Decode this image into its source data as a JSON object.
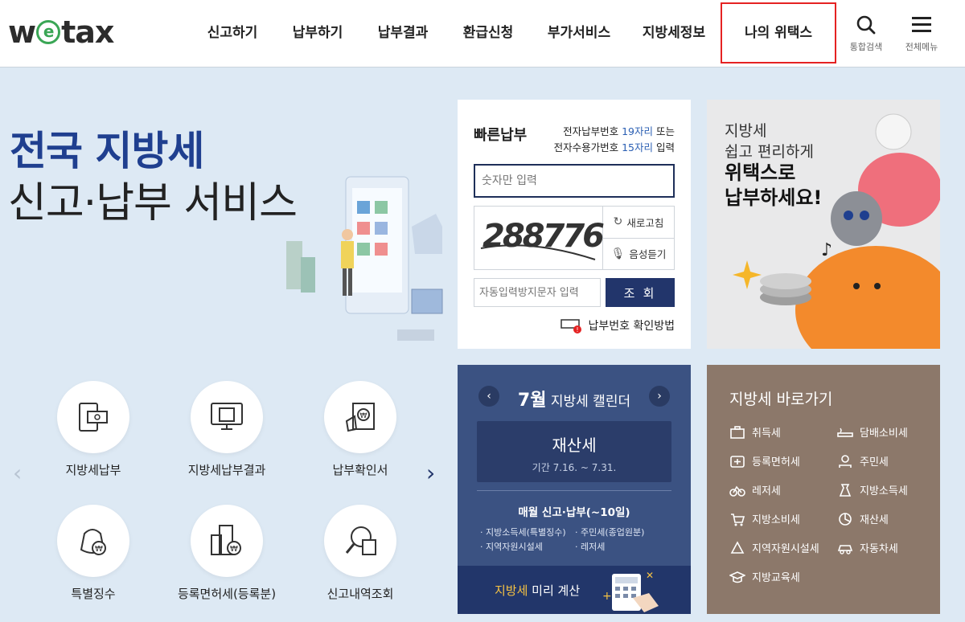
{
  "header": {
    "logo": "wetax",
    "nav": [
      "신고하기",
      "납부하기",
      "납부결과",
      "환급신청",
      "부가서비스",
      "지방세정보",
      "나의 위택스"
    ],
    "search_label": "통합검색",
    "menu_label": "전체메뉴"
  },
  "hero": {
    "title_line1": "전국 지방세",
    "title_line2": "신고·납부 서비스"
  },
  "services": [
    {
      "label": "지방세납부",
      "icon": "tax-payment-icon"
    },
    {
      "label": "지방세납부결과",
      "icon": "payment-result-icon"
    },
    {
      "label": "납부확인서",
      "icon": "payment-certificate-icon"
    },
    {
      "label": "특별징수",
      "icon": "special-collection-icon"
    },
    {
      "label": "등록면허세(등록분)",
      "icon": "registration-tax-icon"
    },
    {
      "label": "신고내역조회",
      "icon": "report-history-icon"
    }
  ],
  "quick_pay": {
    "title": "빠른납부",
    "info_line1_pre": "전자납부번호 ",
    "info_line1_num": "19자리",
    "info_line1_post": " 또는",
    "info_line2_pre": "전자수용가번호 ",
    "info_line2_num": "15자리",
    "info_line2_post": " 입력",
    "input_placeholder": "숫자만 입력",
    "captcha_text": "288776",
    "refresh_label": "새로고침",
    "audio_label": "음성듣기",
    "auto_input_placeholder": "자동입력방지문자 입력",
    "query_button": "조 회",
    "help_link": "납부번호 확인방법"
  },
  "promo": {
    "line1": "지방세",
    "line2": "쉽고 편리하게",
    "line3": "위택스로",
    "line4": "납부하세요!"
  },
  "calendar": {
    "month": "7월",
    "title": "지방세 캘린더",
    "tax_name": "재산세",
    "period": "기간 7.16. ~ 7.31.",
    "monthly_title": "매월 신고·납부(~10일)",
    "items": [
      "지방소득세(특별징수)",
      "주민세(종업원분)",
      "지역자원시설세",
      "레저세"
    ],
    "calc_highlight": "지방세",
    "calc_rest": " 미리 계산"
  },
  "shortcuts": {
    "title": "지방세 바로가기",
    "items": [
      {
        "label": "취득세",
        "icon": "briefcase-icon"
      },
      {
        "label": "담배소비세",
        "icon": "cigarette-icon"
      },
      {
        "label": "등록면허세",
        "icon": "license-icon"
      },
      {
        "label": "주민세",
        "icon": "person-icon"
      },
      {
        "label": "레저세",
        "icon": "bicycle-icon"
      },
      {
        "label": "지방소득세",
        "icon": "money-bag-icon"
      },
      {
        "label": "지방소비세",
        "icon": "cart-icon"
      },
      {
        "label": "재산세",
        "icon": "pie-chart-icon"
      },
      {
        "label": "지역자원시설세",
        "icon": "recycle-icon"
      },
      {
        "label": "자동차세",
        "icon": "car-icon"
      },
      {
        "label": "지방교육세",
        "icon": "graduation-cap-icon"
      }
    ]
  },
  "colors": {
    "brand_navy": "#22356b",
    "highlight_red": "#e52222",
    "hero_blue": "#1f3f8f",
    "calendar_bg": "#3b5282",
    "shortcut_bg": "#8c786a",
    "accent_yellow": "#f5c243"
  }
}
